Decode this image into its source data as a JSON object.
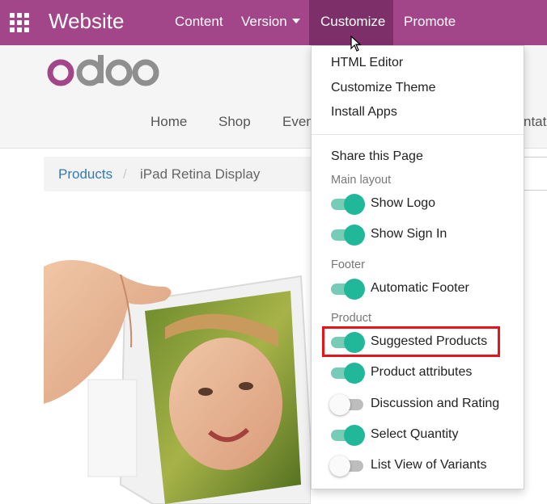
{
  "topbar": {
    "app_title": "Website",
    "menus": [
      "Content",
      "Version",
      "Customize",
      "Promote"
    ],
    "active_menu": "Customize",
    "color": "#a24689"
  },
  "site": {
    "logo_text": "odoo",
    "nav": [
      "Home",
      "Shop",
      "Even",
      "ntat"
    ]
  },
  "breadcrumb": {
    "link": "Products",
    "separator": "/",
    "current": "iPad Retina Display"
  },
  "customize_menu": {
    "items": [
      "HTML Editor",
      "Customize Theme",
      "Install Apps"
    ],
    "share": "Share this Page",
    "sections": [
      {
        "header": "Main layout",
        "toggles": [
          {
            "label": "Show Logo",
            "on": true
          },
          {
            "label": "Show Sign In",
            "on": true
          }
        ]
      },
      {
        "header": "Footer",
        "toggles": [
          {
            "label": "Automatic Footer",
            "on": true
          }
        ]
      },
      {
        "header": "Product",
        "toggles": [
          {
            "label": "Suggested Products",
            "on": true
          },
          {
            "label": "Product attributes",
            "on": true
          },
          {
            "label": "Discussion and Rating",
            "on": false
          },
          {
            "label": "Select Quantity",
            "on": true
          },
          {
            "label": "List View of Variants",
            "on": false
          }
        ]
      }
    ],
    "highlighted": "Suggested Products",
    "toggle_on_color": "#21b799",
    "highlight_color": "#e8141b"
  }
}
